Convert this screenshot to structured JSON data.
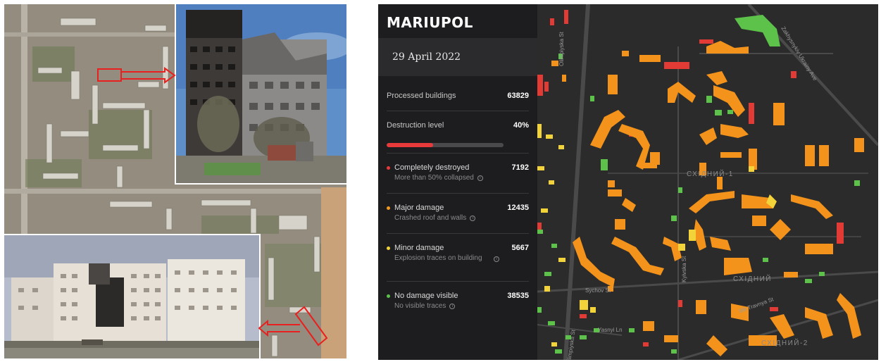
{
  "panel": {
    "city": "MARIUPOL",
    "date": "29 April 2022",
    "processed_label": "Processed buildings",
    "processed_value": "63829",
    "destruction_label": "Destruction level",
    "destruction_value": "40%",
    "destruction_fraction": 0.4,
    "categories": [
      {
        "label": "Completely destroyed",
        "value": "7192",
        "sub": "More than 50% collapsed",
        "color": "#e8393b"
      },
      {
        "label": "Major damage",
        "value": "12435",
        "sub": "Crashed roof and walls",
        "color": "#f39a1e"
      },
      {
        "label": "Minor damage",
        "value": "5667",
        "sub": "Explosion traces on building",
        "color": "#f2d43a"
      },
      {
        "label": "No damage visible",
        "value": "38535",
        "sub": "No visible traces",
        "color": "#5cc24a"
      }
    ]
  },
  "map": {
    "streets": [
      "Olimpiyska St",
      "Zakhysnykiv Ukrainy Ave",
      "Kyivska St",
      "Sychov St",
      "9th Travnya St",
      "Yasnyi Ln",
      "Olimpiyska St"
    ],
    "districts": [
      "СХІДНИЙ-1",
      "СХІДНИЙ",
      "СХІДНИЙ-2"
    ]
  }
}
